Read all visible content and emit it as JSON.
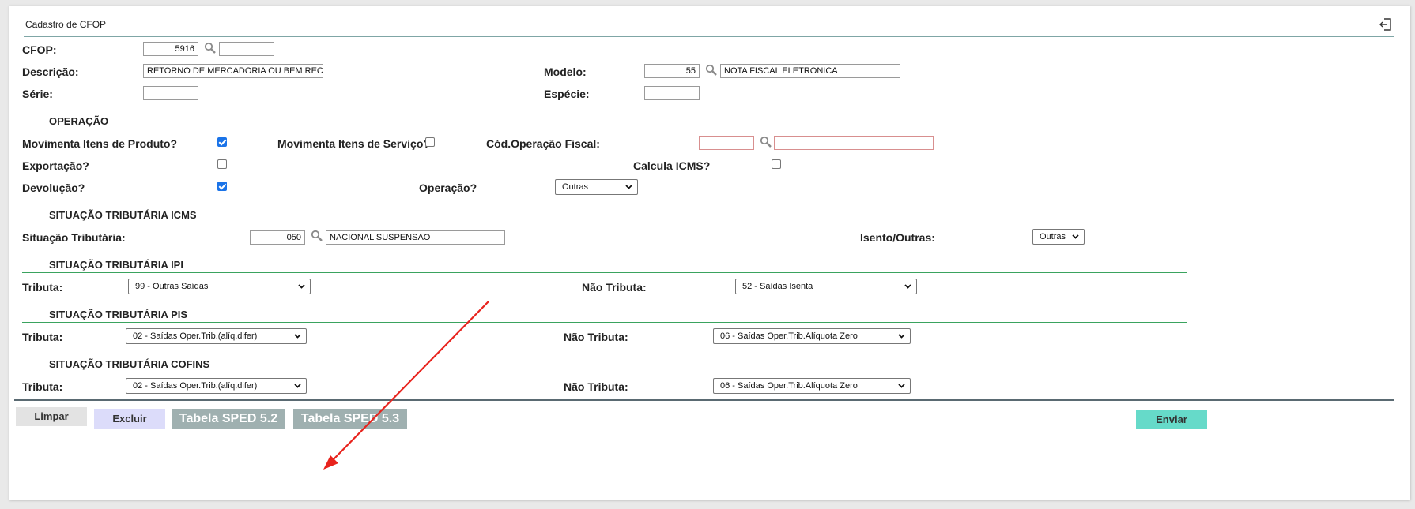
{
  "header": {
    "title": "Cadastro de CFOP",
    "exit_icon": "sign-out-icon"
  },
  "fields": {
    "cfop_label": "CFOP:",
    "cfop_value": "5916",
    "cfop_desc_value": "",
    "descricao_label": "Descrição:",
    "descricao_value": "RETORNO DE MERCADORIA OU BEM RECEBID",
    "modelo_label": "Modelo:",
    "modelo_code": "55",
    "modelo_desc": "NOTA FISCAL ELETRONICA",
    "serie_label": "Série:",
    "serie_value": "",
    "especie_label": "Espécie:",
    "especie_value": ""
  },
  "operacao": {
    "section_title": "OPERAÇÃO",
    "mov_produto_label": "Movimenta Itens de Produto?",
    "mov_produto_checked": true,
    "mov_servico_label": "Movimenta Itens de Serviço?",
    "mov_servico_checked": false,
    "cod_operacao_label": "Cód.Operação Fiscal:",
    "cod_operacao_code": "",
    "cod_operacao_desc": "",
    "exportacao_label": "Exportação?",
    "exportacao_checked": false,
    "calcula_icms_label": "Calcula ICMS?",
    "calcula_icms_checked": false,
    "devolucao_label": "Devolução?",
    "devolucao_checked": true,
    "operacao_label": "Operação?",
    "operacao_value": "Outras"
  },
  "icms": {
    "section_title": "SITUAÇÃO TRIBUTÁRIA ICMS",
    "situacao_label": "Situação Tributária:",
    "situacao_code": "050",
    "situacao_desc": "NACIONAL SUSPENSAO",
    "isento_label": "Isento/Outras:",
    "isento_value": "Outras"
  },
  "ipi": {
    "section_title": "SITUAÇÃO TRIBUTÁRIA IPI",
    "tributa_label": "Tributa:",
    "tributa_value": "99 - Outras Saídas",
    "nao_tributa_label": "Não Tributa:",
    "nao_tributa_value": "52 - Saídas Isenta"
  },
  "pis": {
    "section_title": "SITUAÇÃO TRIBUTÁRIA PIS",
    "tributa_label": "Tributa:",
    "tributa_value": "02 - Saídas Oper.Trib.(alíq.difer)",
    "nao_tributa_label": "Não Tributa:",
    "nao_tributa_value": "06 - Saídas Oper.Trib.Alíquota Zero"
  },
  "cofins": {
    "section_title": "SITUAÇÃO TRIBUTÁRIA COFINS",
    "tributa_label": "Tributa:",
    "tributa_value": "02 - Saídas Oper.Trib.(alíq.difer)",
    "nao_tributa_label": "Não Tributa:",
    "nao_tributa_value": "06 - Saídas Oper.Trib.Alíquota Zero"
  },
  "buttons": {
    "limpar": "Limpar",
    "excluir": "Excluir",
    "sped52": "Tabela SPED 5.2",
    "sped53": "Tabela SPED 5.3",
    "enviar": "Enviar"
  },
  "colors": {
    "section_line": "#3aa35e",
    "enviar_bg": "#66dac9",
    "sped_bg": "#9fb0b0",
    "annotation_arrow": "#e8231d"
  }
}
